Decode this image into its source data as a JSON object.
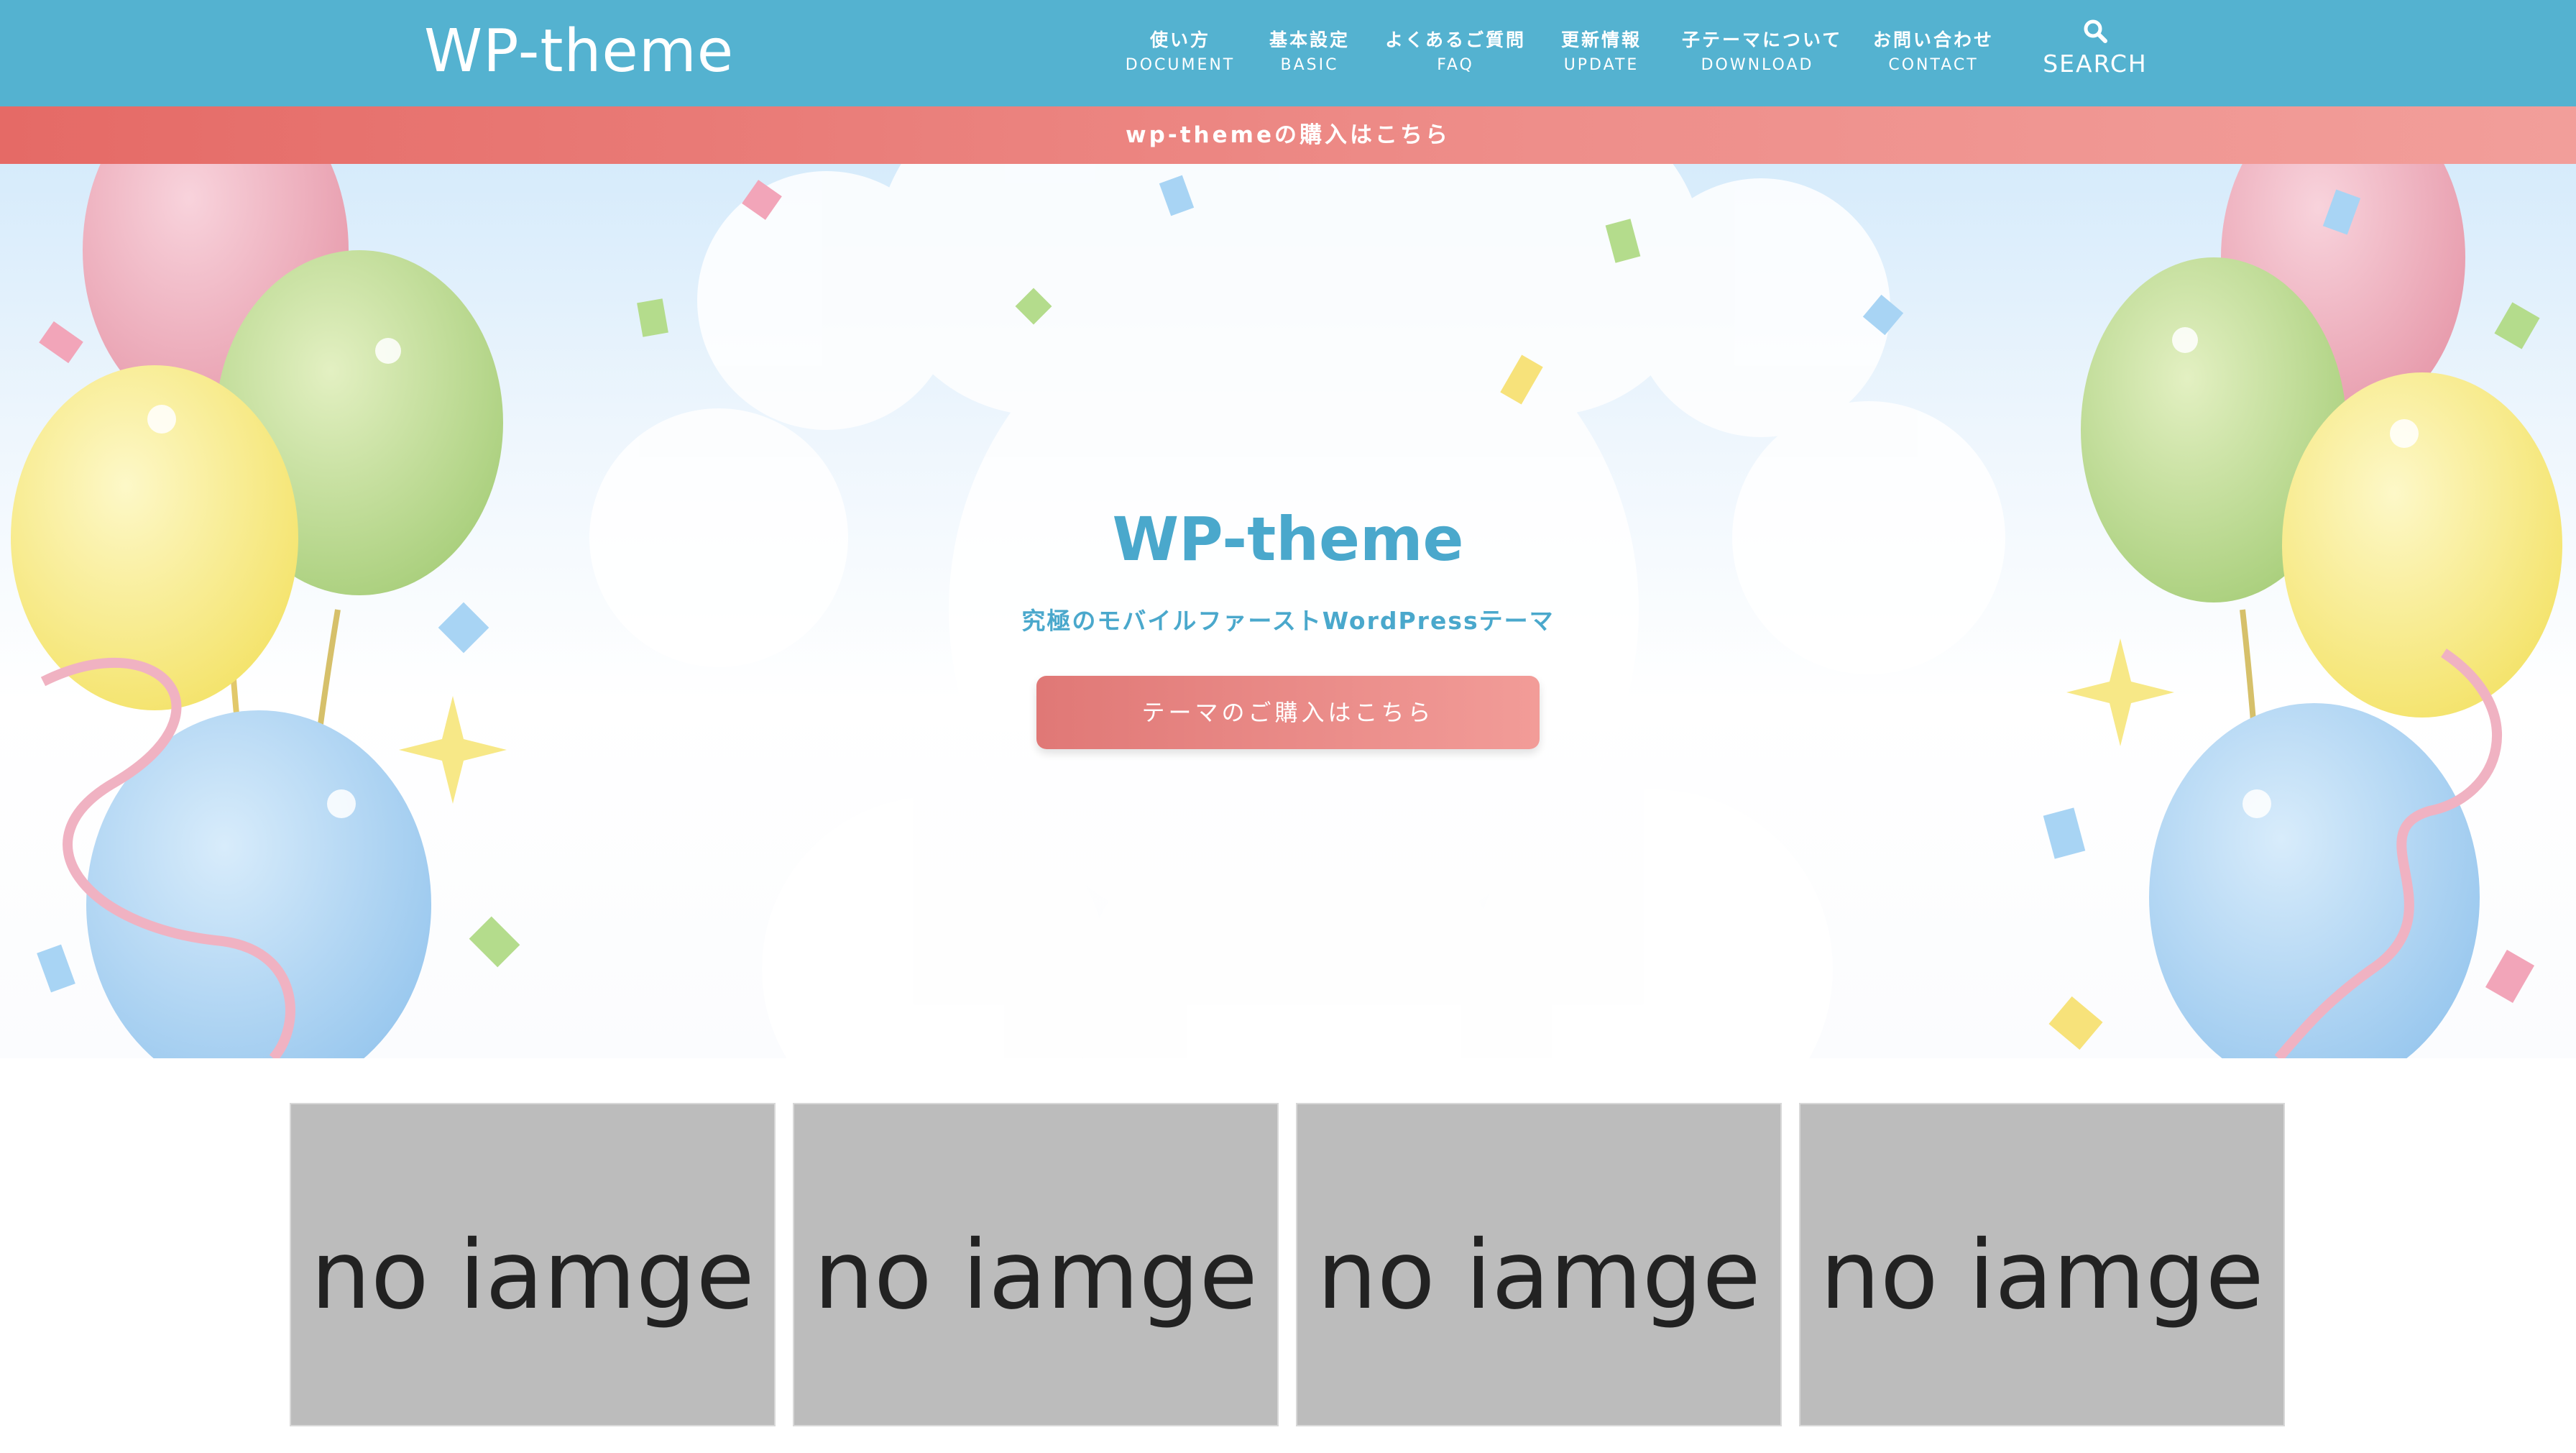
{
  "header": {
    "logo": "WP-theme",
    "nav": [
      {
        "ja": "使い方",
        "en": "DOCUMENT"
      },
      {
        "ja": "基本設定",
        "en": "BASIC"
      },
      {
        "ja": "よくあるご質問",
        "en": "FAQ"
      },
      {
        "ja": "更新情報",
        "en": "UPDATE"
      },
      {
        "ja": "子テーマについて",
        "en": "DOWNLOAD"
      },
      {
        "ja": "お問い合わせ",
        "en": "CONTACT"
      }
    ],
    "search_label": "SEARCH",
    "search_icon": "search-icon"
  },
  "notice": {
    "text": "wp-themeの購入はこちら"
  },
  "hero": {
    "title": "WP-theme",
    "subtitle": "究極のモバイルファーストWordPressテーマ",
    "button_label": "テーマのご購入はこちら"
  },
  "cards": [
    {
      "label": "no iamge"
    },
    {
      "label": "no iamge"
    },
    {
      "label": "no iamge"
    },
    {
      "label": "no iamge"
    }
  ],
  "colors": {
    "header_bg": "#54b2d0",
    "notice_bg": "#ea7c78",
    "accent_text": "#4aa8cc",
    "button_bg": "#e88682",
    "card_bg": "#bcbcbc"
  }
}
